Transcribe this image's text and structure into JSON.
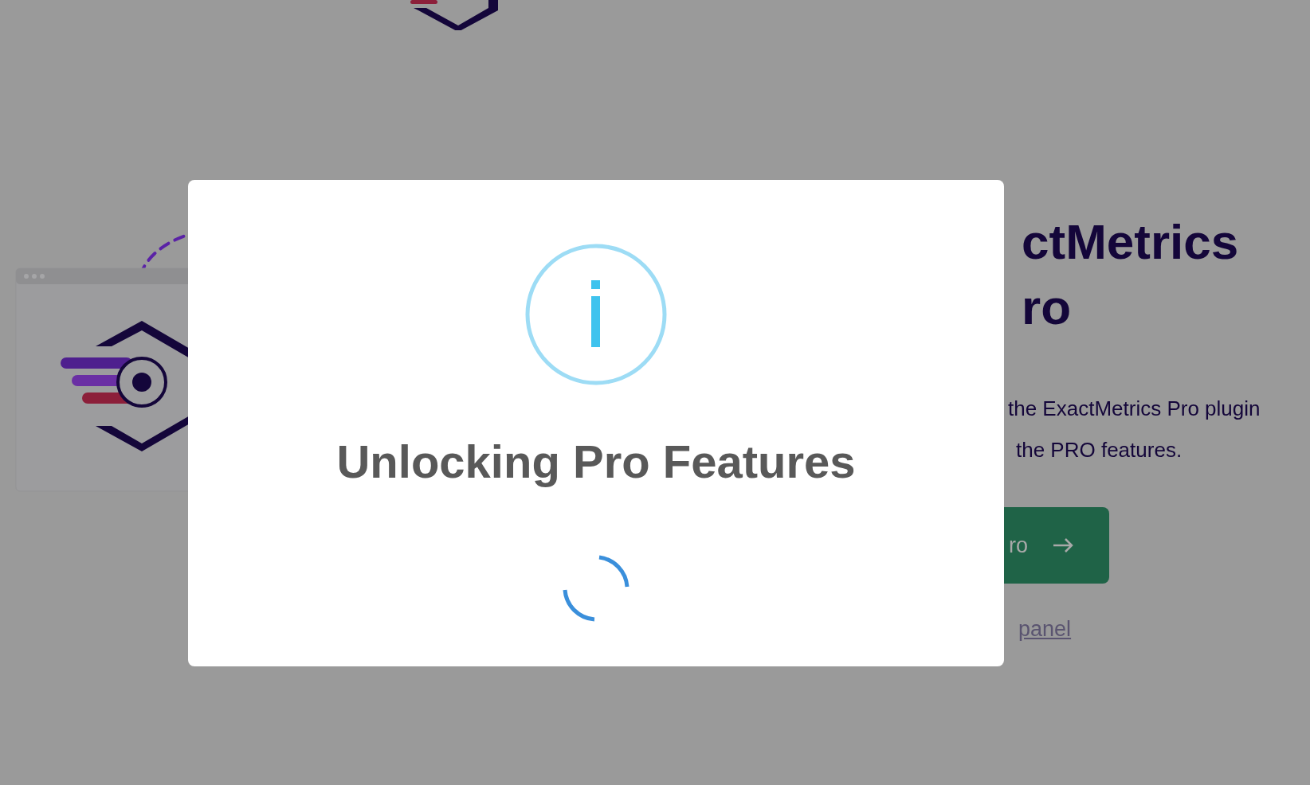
{
  "background": {
    "heading_lines": [
      "ctMetrics",
      "ro"
    ],
    "description_lines": [
      "the ExactMetrics Pro plugin",
      "the PRO features."
    ],
    "button": {
      "label": "ro"
    },
    "link": "panel"
  },
  "modal": {
    "title": "Unlocking Pro Features"
  }
}
